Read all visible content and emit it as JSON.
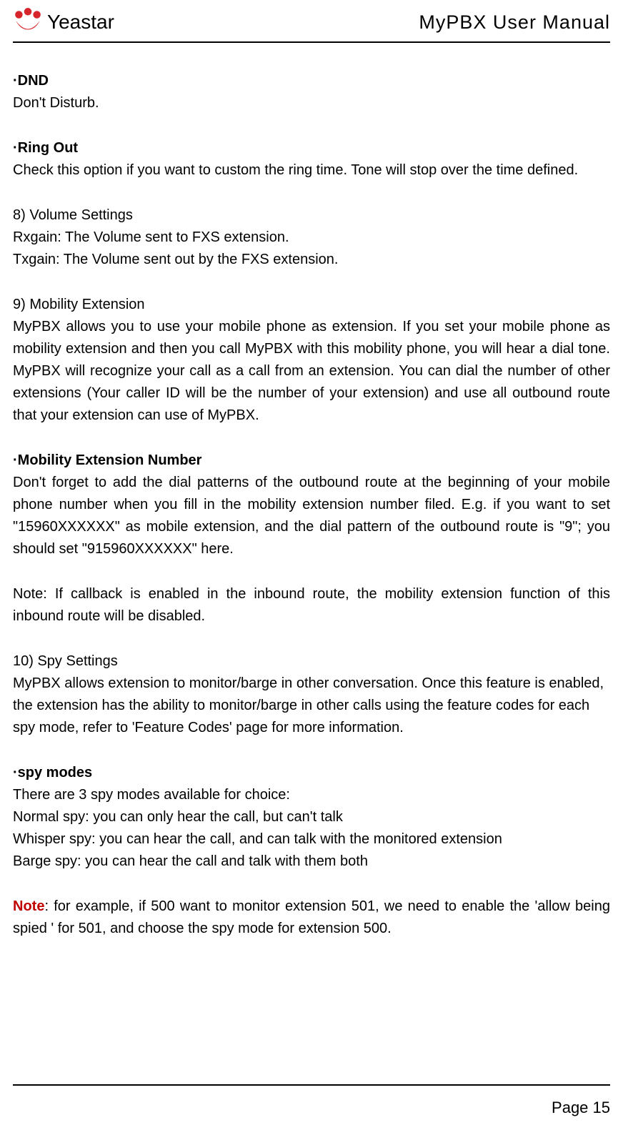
{
  "header": {
    "brand": "Yeastar",
    "title": "MyPBX User Manual"
  },
  "sections": {
    "dnd_label": "·DND",
    "dnd_desc": "Don't Disturb.",
    "ringout_label": "·Ring Out",
    "ringout_desc": "Check this option if you want to custom the ring time. Tone will stop over the time defined.",
    "vol_head": "8) Volume Settings",
    "vol_rx": "Rxgain: The Volume sent to FXS extension.",
    "vol_tx": "Txgain: The Volume sent out by the FXS extension.",
    "mob_head": "9) Mobility Extension",
    "mob_desc": "MyPBX allows you to use your mobile phone as extension. If you set your mobile phone as mobility extension and then you call MyPBX with this mobility phone, you will hear a dial tone. MyPBX will recognize your call as a call from an extension. You can dial the number of other extensions (Your caller ID will be the number of your extension) and use all outbound route that your extension can use of MyPBX.",
    "mobnum_label": "·Mobility Extension Number",
    "mobnum_desc": "Don't forget to add the dial patterns of the outbound route at the beginning of your mobile phone number when you fill in the mobility extension number filed. E.g. if you want to set \"15960XXXXXX\" as mobile extension, and the dial pattern of the outbound route is \"9\"; you should set \"915960XXXXXX\" here.",
    "mobnum_note": "Note: If callback is enabled in the inbound route, the mobility extension function of this inbound route will be disabled.",
    "spy_head": "10) Spy Settings",
    "spy_desc": "MyPBX allows extension to monitor/barge in other conversation. Once this feature is enabled, the extension has the ability to monitor/barge in other calls using the feature codes for each spy mode, refer to 'Feature Codes' page for more information.",
    "spymodes_label": "·spy modes",
    "spymodes_intro": "There are 3 spy modes available for choice:",
    "spymodes_normal": "Normal spy: you can only hear the call, but can't talk",
    "spymodes_whisper": "Whisper spy: you can hear the call, and can talk with the monitored extension",
    "spymodes_barge": "Barge spy: you can hear the call and talk with them both",
    "note_word": "Note",
    "note_body": ": for example, if 500 want to monitor extension 501, we need to enable the 'allow being spied ' for 501, and choose the spy mode for extension 500."
  },
  "footer": {
    "page": "Page 15"
  }
}
